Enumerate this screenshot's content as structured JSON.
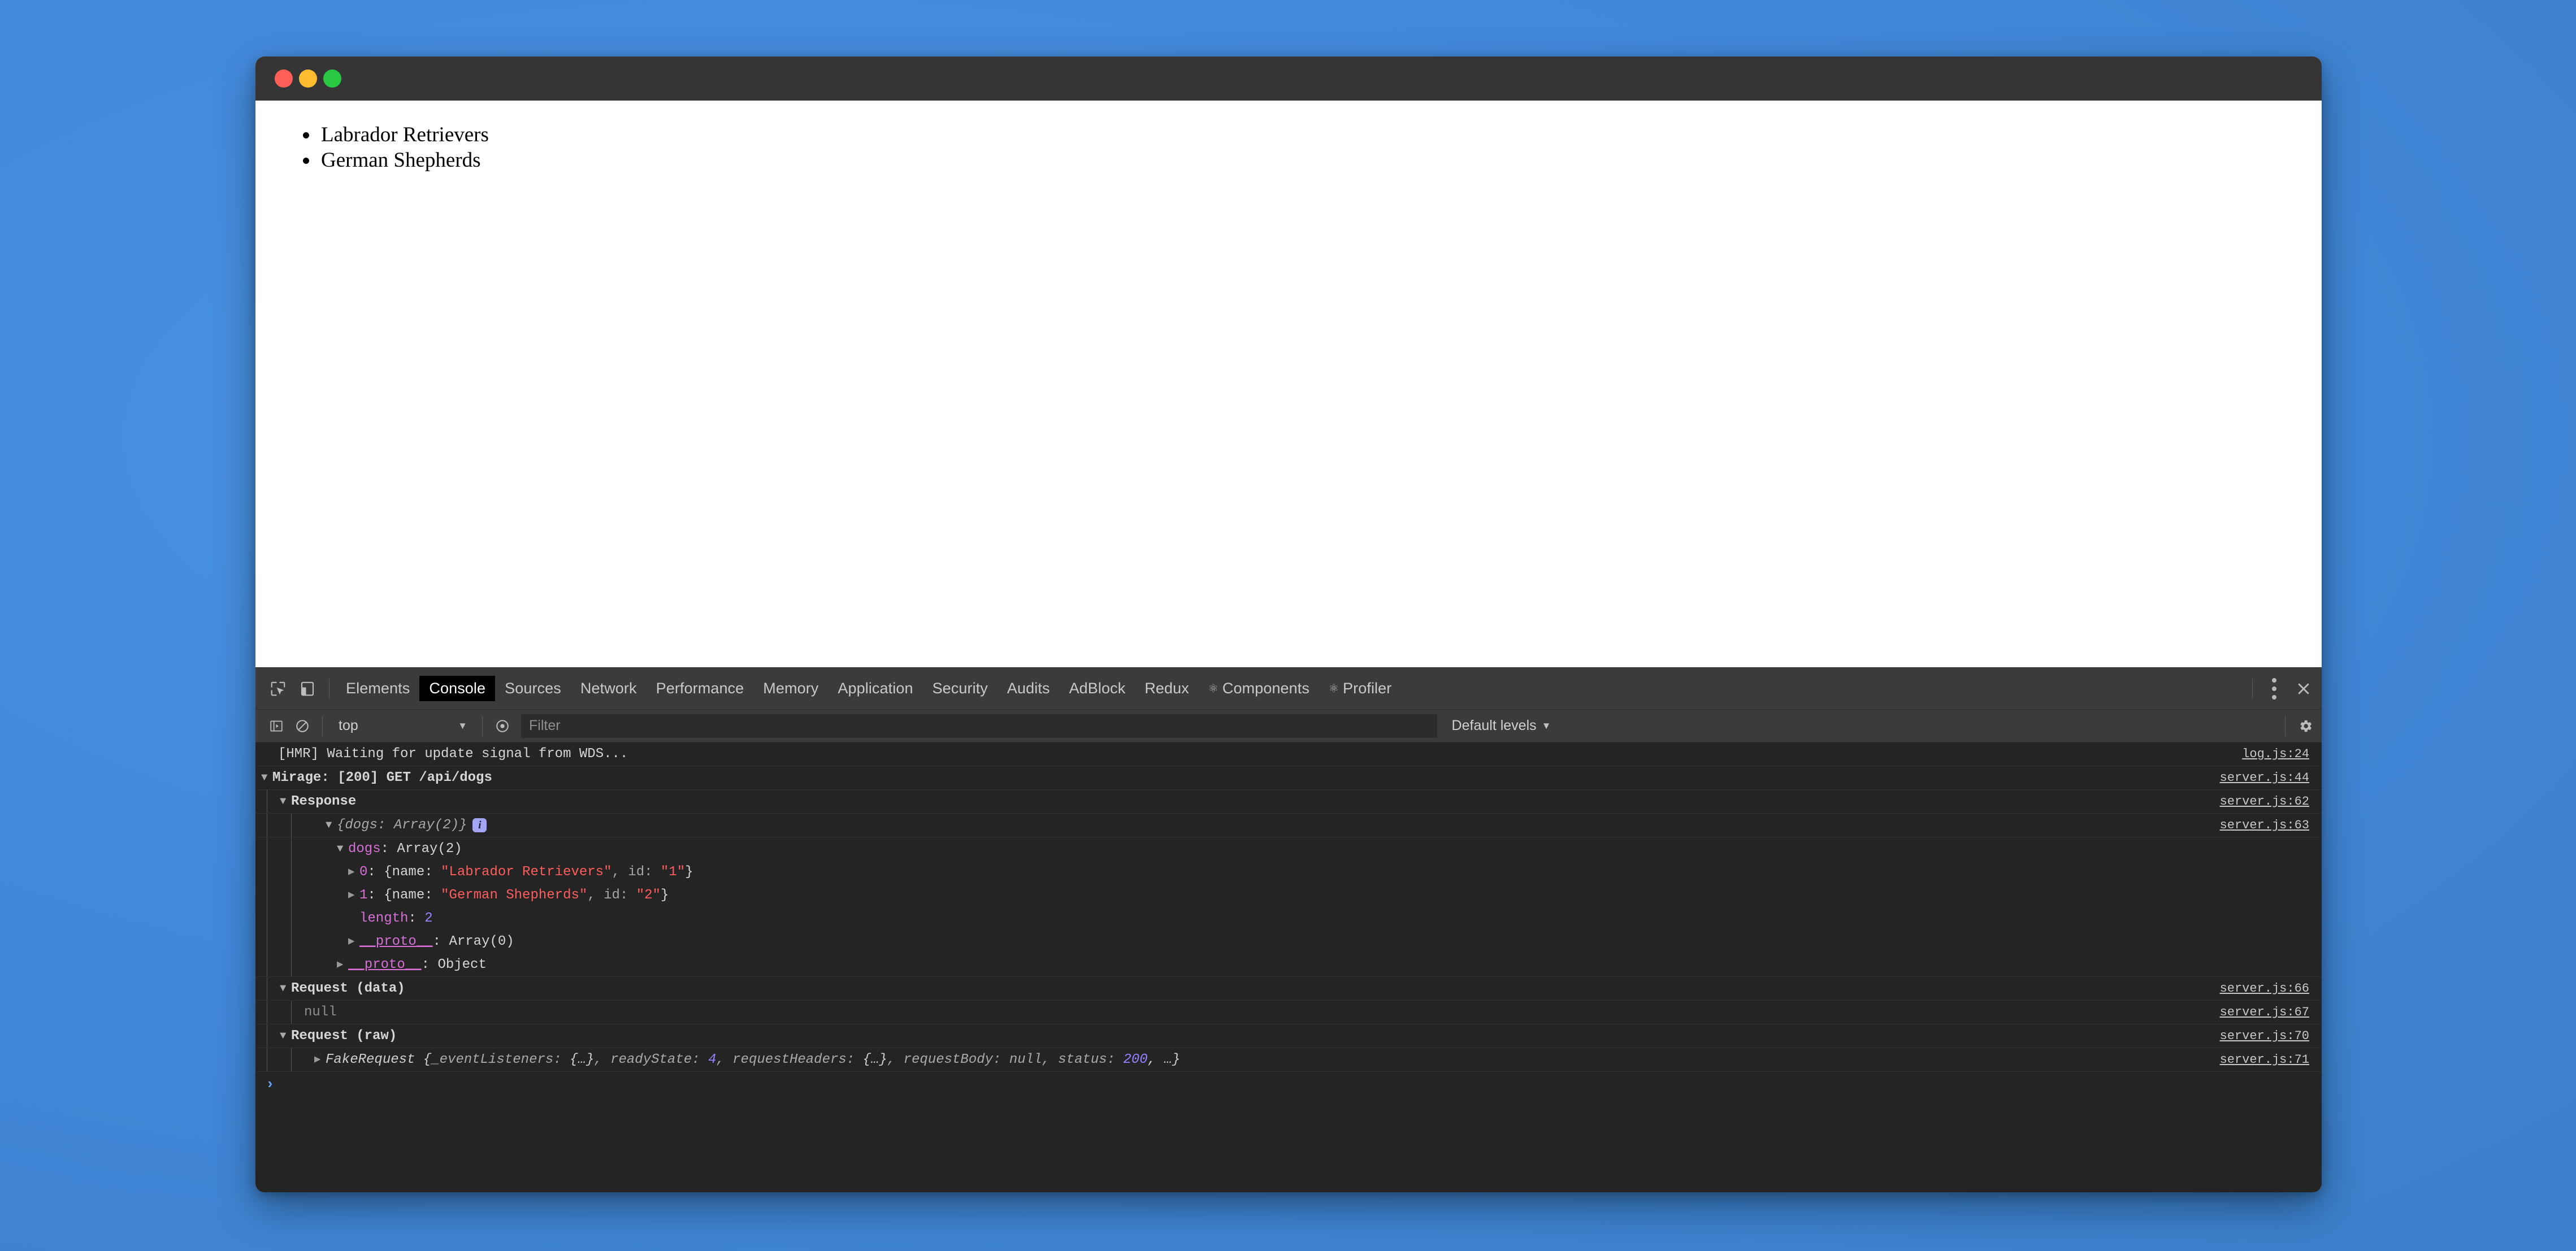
{
  "window": {
    "traffic_lights": [
      "close",
      "minimize",
      "zoom"
    ],
    "colors": {
      "desktop_blue": "#4289dc",
      "titlebar": "#353535",
      "devtools_bg": "#242424",
      "devtools_toolbar": "#3b3b3b",
      "accent_link": "#6ba5f7",
      "string_red": "#f28b82",
      "property_pink": "#d670d6",
      "number_purple": "#9980ff",
      "traffic_red": "#ff5f57",
      "traffic_yellow": "#febc2e",
      "traffic_green": "#28c840"
    }
  },
  "page": {
    "list_items": [
      "Labrador Retrievers",
      "German Shepherds"
    ]
  },
  "devtools": {
    "tabs": [
      {
        "label": "Elements",
        "active": false,
        "icon": ""
      },
      {
        "label": "Console",
        "active": true,
        "icon": ""
      },
      {
        "label": "Sources",
        "active": false,
        "icon": ""
      },
      {
        "label": "Network",
        "active": false,
        "icon": ""
      },
      {
        "label": "Performance",
        "active": false,
        "icon": ""
      },
      {
        "label": "Memory",
        "active": false,
        "icon": ""
      },
      {
        "label": "Application",
        "active": false,
        "icon": ""
      },
      {
        "label": "Security",
        "active": false,
        "icon": ""
      },
      {
        "label": "Audits",
        "active": false,
        "icon": ""
      },
      {
        "label": "AdBlock",
        "active": false,
        "icon": ""
      },
      {
        "label": "Redux",
        "active": false,
        "icon": ""
      },
      {
        "label": "Components",
        "active": false,
        "icon": "react-atom-icon"
      },
      {
        "label": "Profiler",
        "active": false,
        "icon": "react-atom-icon"
      }
    ],
    "toolbar_icons": {
      "inspect": "inspect-element-icon",
      "device": "device-toolbar-icon",
      "more": "more-options-icon",
      "close": "close-devtools-icon"
    },
    "console_toolbar": {
      "sidebar_icon": "console-sidebar-icon",
      "clear_icon": "clear-console-icon",
      "context": "top",
      "context_caret": "▼",
      "eye_icon": "live-expression-icon",
      "filter_placeholder": "Filter",
      "filter_value": "",
      "levels_label": "Default levels",
      "levels_caret": "▼",
      "settings_icon": "settings-gear-icon"
    },
    "prompt_symbol": "›"
  },
  "console": {
    "rows": [
      {
        "id": "hmr",
        "indent": 0,
        "text": "[HMR] Waiting for update signal from WDS...",
        "source": "log.js:24"
      },
      {
        "id": "mirage-group",
        "indent": 0,
        "triangle": "▼",
        "text": "Mirage: [200] GET /api/dogs",
        "source": "server.js:44"
      },
      {
        "id": "response-group",
        "indent": 1,
        "triangle": "▼",
        "text": "Response",
        "source": "server.js:62"
      },
      {
        "id": "dogs-object",
        "indent": 2,
        "triangle": "▼",
        "text": "{dogs: Array(2)}",
        "badge": "i",
        "source": "server.js:63"
      },
      {
        "id": "dogs-array",
        "indent": 3,
        "triangle": "▼",
        "key": "dogs",
        "value": "Array(2)",
        "source": ""
      },
      {
        "id": "dog-0",
        "indent": 4,
        "triangle": "▶",
        "index": "0",
        "text": "{name: \"Labrador Retrievers\", id: \"1\"}",
        "name_value": "\"Labrador Retrievers\"",
        "id_value": "\"1\"",
        "source": ""
      },
      {
        "id": "dog-1",
        "indent": 4,
        "triangle": "▶",
        "index": "1",
        "text": "{name: \"German Shepherds\", id: \"2\"}",
        "name_value": "\"German Shepherds\"",
        "id_value": "\"2\"",
        "source": ""
      },
      {
        "id": "length",
        "indent": 4,
        "key": "length",
        "value": "2",
        "source": ""
      },
      {
        "id": "array-proto",
        "indent": 4,
        "triangle": "▶",
        "key": "__proto__",
        "value": "Array(0)",
        "source": ""
      },
      {
        "id": "object-proto",
        "indent": 3,
        "triangle": "▶",
        "key": "__proto__",
        "value": "Object",
        "source": ""
      },
      {
        "id": "request-data-group",
        "indent": 1,
        "triangle": "▼",
        "text": "Request (data)",
        "source": "server.js:66"
      },
      {
        "id": "request-data-null",
        "indent": 2,
        "text": "null",
        "source": "server.js:67"
      },
      {
        "id": "request-raw-group",
        "indent": 1,
        "triangle": "▼",
        "text": "Request (raw)",
        "source": "server.js:70"
      },
      {
        "id": "fake-request",
        "indent": 2,
        "triangle": "▶",
        "text": "FakeRequest {_eventListeners: {…}, readyState: 4, requestHeaders: {…}, requestBody: null, status: 200, …}",
        "source": "server.js:71"
      }
    ],
    "fake_request_parts": {
      "ctor": "FakeRequest ",
      "open": "{",
      "k1": "_eventListeners: ",
      "v1": "{…}",
      "k2": ", readyState: ",
      "v2": "4",
      "k3": ", requestHeaders: ",
      "v3": "{…}",
      "k4": ", requestBody: ",
      "v4": "null",
      "k5": ", status: ",
      "v5": "200",
      "tail": ", …}"
    }
  }
}
